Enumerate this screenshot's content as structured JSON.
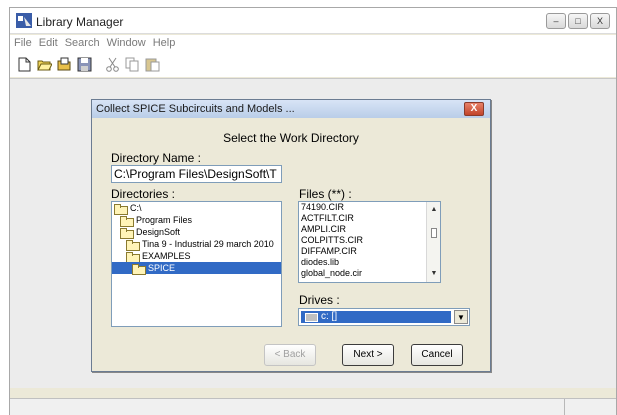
{
  "app": {
    "title": "Library Manager",
    "window_buttons": [
      "–",
      "□",
      "X"
    ]
  },
  "menu": [
    "File",
    "Edit",
    "Search",
    "Window",
    "Help"
  ],
  "toolbar_icons": [
    "new-icon",
    "open-icon",
    "open-folder-icon",
    "save-icon",
    "cut-icon",
    "copy-icon",
    "paste-icon"
  ],
  "dialog": {
    "title": "Collect SPICE Subcircuits and Models ...",
    "close": "X",
    "heading": "Select the Work Directory",
    "directory_name_label": "Directory Name :",
    "directory_name_value": "C:\\Program Files\\DesignSoft\\T",
    "directories_label": "Directories :",
    "directories": [
      {
        "label": "C:\\",
        "indent": 0,
        "selected": false
      },
      {
        "label": "Program Files",
        "indent": 1,
        "selected": false
      },
      {
        "label": "DesignSoft",
        "indent": 1,
        "selected": false
      },
      {
        "label": "Tina 9 - Industrial 29 march 2010",
        "indent": 2,
        "selected": false
      },
      {
        "label": "EXAMPLES",
        "indent": 2,
        "selected": false
      },
      {
        "label": "SPICE",
        "indent": 3,
        "selected": true
      }
    ],
    "files_label": "Files (**) :",
    "files": [
      "74190.CIR",
      "ACTFILT.CIR",
      "AMPLI.CIR",
      "COLPITTS.CIR",
      "DIFFAMP.CIR",
      "diodes.lib",
      "global_node.cir"
    ],
    "drives_label": "Drives :",
    "drive_value": "c: []",
    "buttons": {
      "back": "< Back",
      "next": "Next >",
      "cancel": "Cancel"
    }
  },
  "colors": {
    "selection": "#316ac5",
    "dialog_bg": "#ece9d8"
  }
}
